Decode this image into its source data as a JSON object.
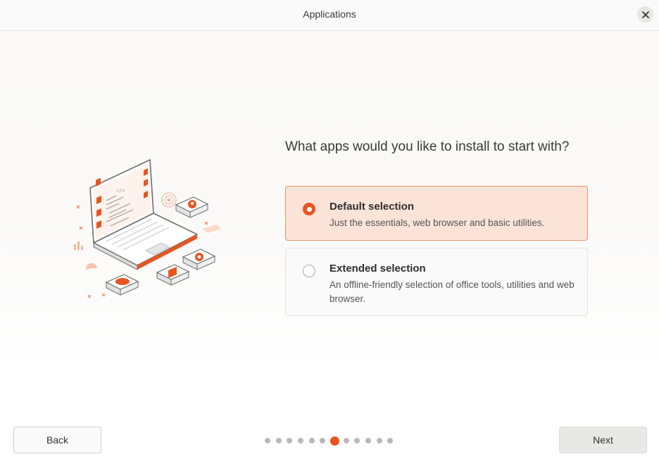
{
  "window": {
    "title": "Applications"
  },
  "main": {
    "question": "What apps would you like to install to start with?",
    "options": [
      {
        "title": "Default selection",
        "description": "Just the essentials, web browser and basic utilities.",
        "selected": true
      },
      {
        "title": "Extended selection",
        "description": "An offline-friendly selection of office tools, utilities and web browser.",
        "selected": false
      }
    ]
  },
  "footer": {
    "back_label": "Back",
    "next_label": "Next",
    "pager": {
      "total": 12,
      "current": 7
    }
  },
  "colors": {
    "accent": "#e95420",
    "selected_bg": "#fbe3d8",
    "selected_border": "#e8936a"
  },
  "icons": {
    "close": "close-icon",
    "illustration": "laptop-apps-illustration"
  }
}
